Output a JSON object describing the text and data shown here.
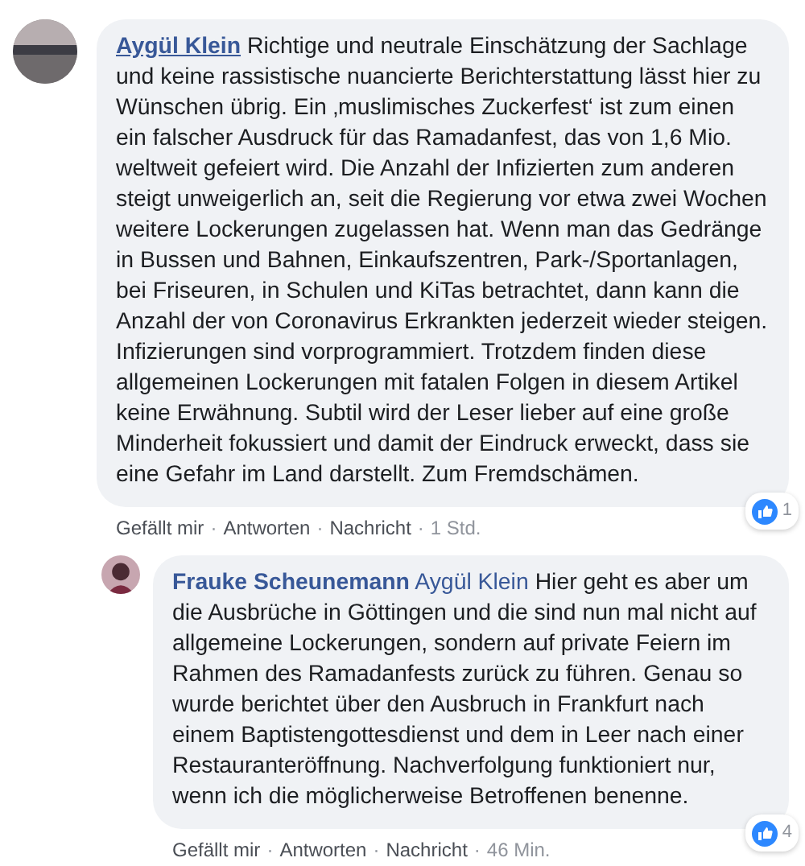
{
  "separator": "·",
  "comments": [
    {
      "author": "Aygül Klein",
      "author_underlined": true,
      "text": "Richtige und neutrale Einschätzung der Sachlage und keine rassistische nuancierte Berichterstattung lässt hier zu Wünschen übrig. Ein ‚muslimisches Zuckerfest‘ ist zum einen ein falscher Ausdruck für das Ramadanfest, das von 1,6 Mio. weltweit gefeiert wird. Die Anzahl der Infizierten zum anderen steigt unweigerlich an, seit die Regierung vor etwa zwei Wochen weitere Lockerungen zugelassen hat. Wenn man das Gedränge in Bussen und Bahnen, Einkaufszentren, Park-/Sportanlagen, bei Friseuren, in Schulen und KiTas betrachtet, dann kann die Anzahl der von Coronavirus Erkrankten jederzeit wieder steigen. Infizierungen sind vorprogrammiert. Trotzdem finden diese allgemeinen Lockerungen mit fatalen Folgen in diesem Artikel keine Erwähnung. Subtil wird der Leser lieber auf eine große Minderheit fokussiert und damit der Eindruck erweckt, dass sie eine Gefahr im Land darstellt. Zum Fremdschämen.",
      "actions": [
        "Gefällt mir",
        "Antworten",
        "Nachricht"
      ],
      "time": "1 Std.",
      "like_count": "1",
      "children": [
        {
          "author": "Frauke Scheunemann",
          "author_underlined": false,
          "mention": "Aygül Klein",
          "text": "Hier geht es aber um die Ausbrüche in Göttingen und die sind nun mal nicht auf allgemeine Lockerungen, sondern auf private Feiern im Rahmen des Ramadanfests zurück zu führen. Genau so wurde berichtet über den Ausbruch in Frankfurt nach einem Baptistengottesdienst und dem in Leer nach einer Restauranteröffnung. Nachverfolgung funktioniert nur, wenn ich die möglicherweise Betroffenen benenne.",
          "actions": [
            "Gefällt mir",
            "Antworten",
            "Nachricht"
          ],
          "time": "46 Min.",
          "like_count": "4"
        }
      ]
    }
  ]
}
